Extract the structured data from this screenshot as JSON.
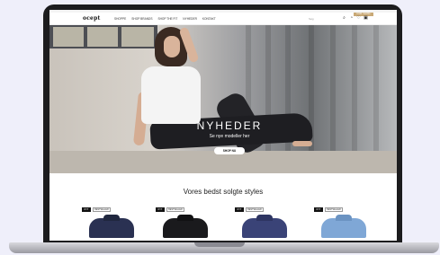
{
  "nav": {
    "logo": "ocept",
    "links": [
      "SHOPPE",
      "SHOP BRANDS",
      "SHOP THE FIT",
      "NYHEDER",
      "KONTAKT"
    ],
    "search_placeholder": "Søg",
    "cta": "KOM I GANG"
  },
  "hero": {
    "title": "NYHEDER",
    "subtitle": "Se nye modeller her",
    "button": "SHOP NU"
  },
  "bestsellers": {
    "title": "Vores bedst solgte styles",
    "products": [
      {
        "tags": [
          "NYT",
          "BESTSELLER"
        ],
        "color": "#2a3152",
        "collar": "#20273f"
      },
      {
        "tags": [
          "NYT",
          "BESTSELLER"
        ],
        "color": "#1a1a1d",
        "collar": "#111113"
      },
      {
        "tags": [
          "NYT",
          "BESTSELLER"
        ],
        "color": "#3a4377",
        "collar": "#2e3562"
      },
      {
        "tags": [
          "NYT",
          "BESTSELLER"
        ],
        "color": "#7fa7d6",
        "collar": "#6b93c2"
      }
    ]
  },
  "icons": [
    "search-icon",
    "user-icon",
    "heart-icon",
    "bag-icon"
  ]
}
